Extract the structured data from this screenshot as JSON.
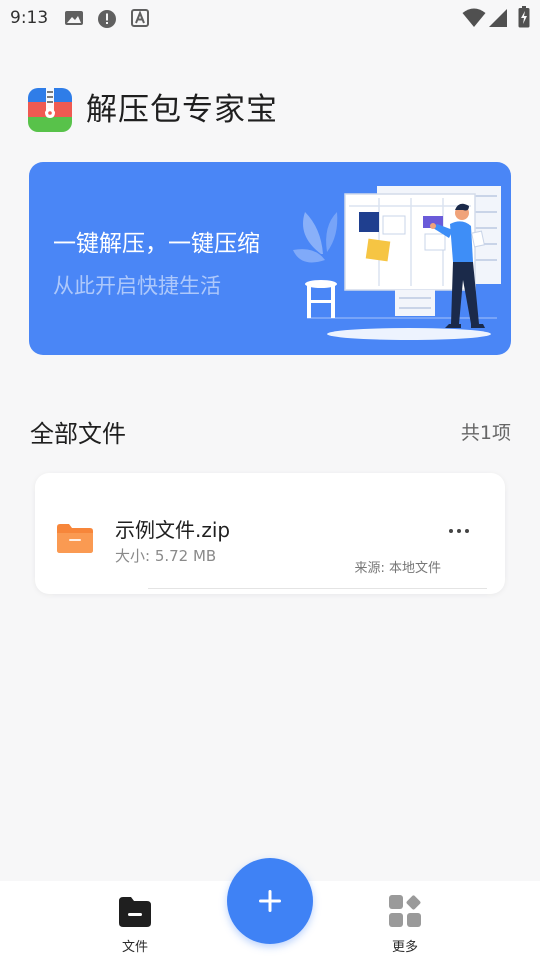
{
  "status_bar": {
    "time": "9:13",
    "left_icons": [
      "image-icon",
      "alert-icon",
      "a-box-icon"
    ],
    "right_icons": [
      "wifi-icon",
      "signal-icon",
      "battery-charging-icon"
    ]
  },
  "header": {
    "title": "解压包专家宝",
    "logo_icon": "zip-app-logo-icon"
  },
  "banner": {
    "title": "一键解压，一键压缩",
    "subtitle": "从此开启快捷生活",
    "illustration": "planning-board-illustration"
  },
  "section": {
    "title": "全部文件",
    "count": "共1项"
  },
  "files": [
    {
      "name": "示例文件.zip",
      "size": "大小: 5.72 MB",
      "source": "来源: 本地文件",
      "icon": "folder-zip-icon"
    }
  ],
  "bottom_nav": {
    "items": [
      {
        "label": "文件",
        "icon": "file-tab-icon"
      },
      {
        "label": "更多",
        "icon": "more-grid-icon"
      }
    ],
    "fab_icon": "plus-icon"
  },
  "colors": {
    "accent": "#3f82f5",
    "banner": "#4a86f6",
    "folder": "#f7863a",
    "background": "#f7f7f8"
  }
}
